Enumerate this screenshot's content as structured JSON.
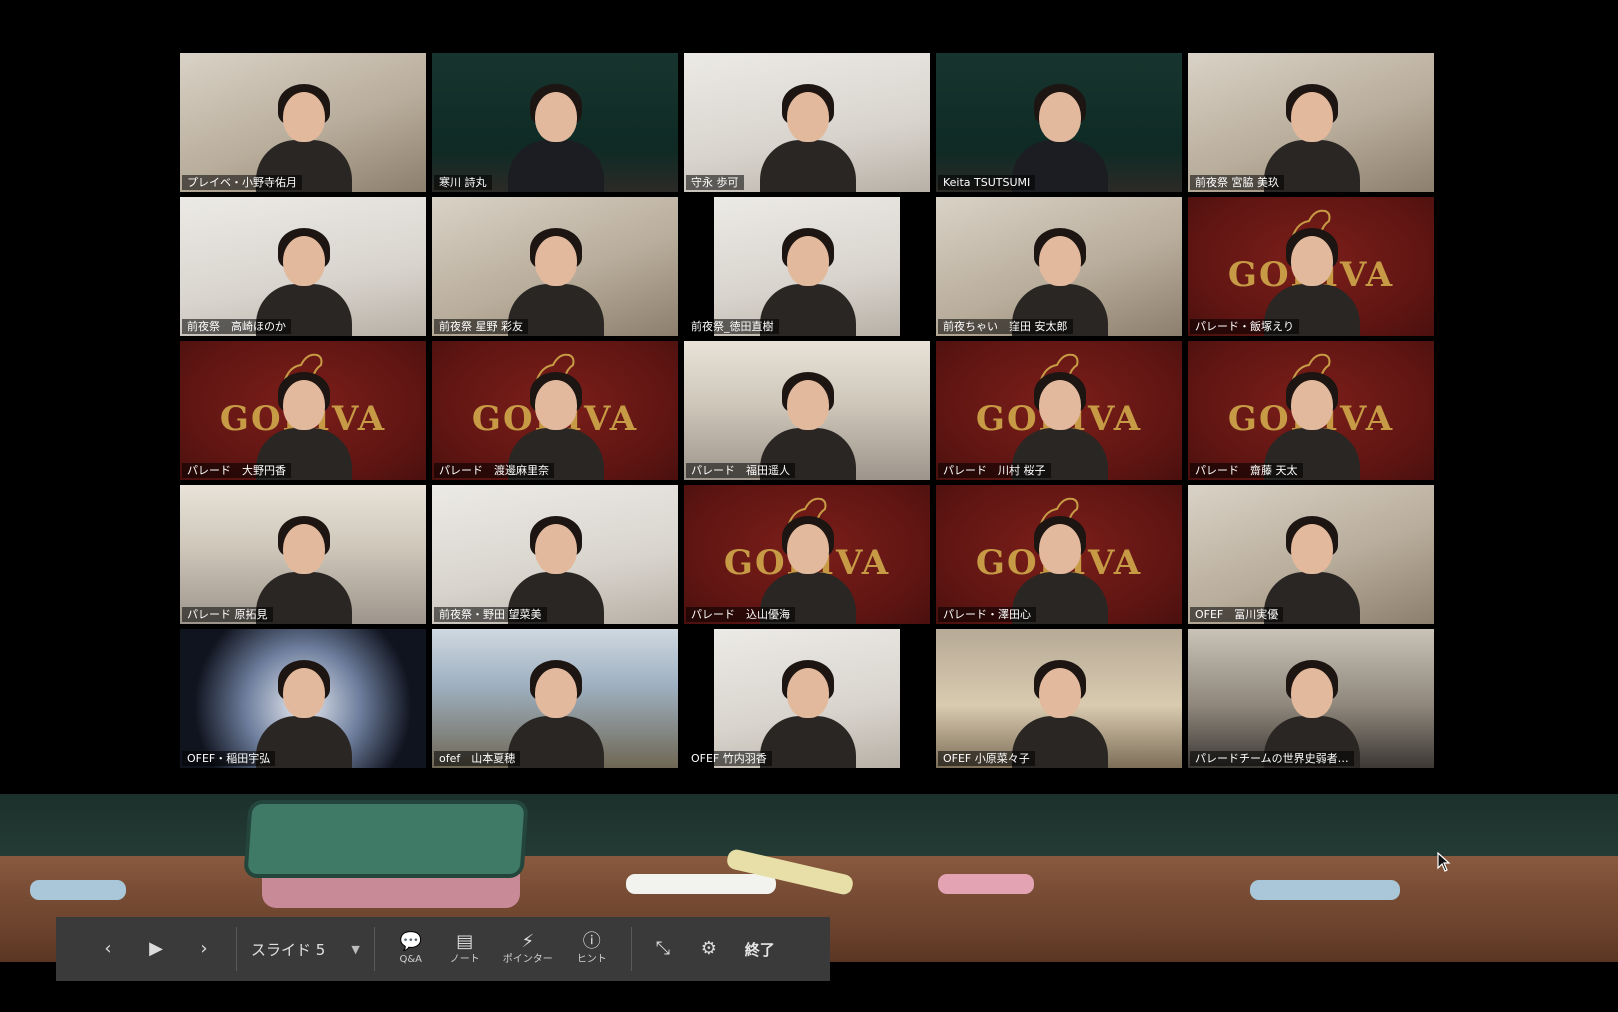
{
  "participants": [
    {
      "name": "プレイベ・小野寺佑月",
      "bg": "room",
      "active": false
    },
    {
      "name": "寒川 詩丸",
      "bg": "board",
      "active": true
    },
    {
      "name": "守永 歩可",
      "bg": "white",
      "active": false
    },
    {
      "name": "Keita TSUTSUMI",
      "bg": "board",
      "active": false
    },
    {
      "name": "前夜祭 宮脇 美玖",
      "bg": "room",
      "active": false
    },
    {
      "name": "前夜祭　高崎ほのか",
      "bg": "white",
      "active": false
    },
    {
      "name": "前夜祭 星野 彩友",
      "bg": "room",
      "active": false
    },
    {
      "name": "前夜祭_徳田直樹",
      "bg": "white",
      "active": false,
      "pillar": true
    },
    {
      "name": "前夜ちゃい　窪田 安太郎",
      "bg": "room",
      "active": false
    },
    {
      "name": "パレード・飯塚えり",
      "bg": "godiva",
      "active": false
    },
    {
      "name": "パレード　大野円香",
      "bg": "godiva",
      "active": false
    },
    {
      "name": "パレード　渡邊麻里奈",
      "bg": "godiva",
      "active": false
    },
    {
      "name": "パレード　福田遥人",
      "bg": "floor",
      "active": false
    },
    {
      "name": "パレード　川村 桜子",
      "bg": "godiva",
      "active": false
    },
    {
      "name": "パレード　齋藤 天太",
      "bg": "godiva",
      "active": false
    },
    {
      "name": "パレード 原拓見",
      "bg": "floor",
      "active": false
    },
    {
      "name": "前夜祭・野田 望菜美",
      "bg": "white",
      "active": false
    },
    {
      "name": "パレード　込山優海",
      "bg": "godiva",
      "active": false
    },
    {
      "name": "パレード・澤田心",
      "bg": "godiva",
      "active": false
    },
    {
      "name": "OFEF　冨川実優",
      "bg": "room",
      "active": false
    },
    {
      "name": "OFEF・稲田宇弘",
      "bg": "manga",
      "active": false
    },
    {
      "name": "ofef　山本夏穂",
      "bg": "anime",
      "active": false
    },
    {
      "name": "OFEF 竹内羽香",
      "bg": "white",
      "active": false,
      "pillar": true
    },
    {
      "name": "OFEF 小原菜々子",
      "bg": "couch",
      "active": false
    },
    {
      "name": "パレードチームの世界史弱者…",
      "bg": "dark",
      "active": false
    }
  ],
  "godiva_brand": "GODIVA",
  "toolbar": {
    "prev_icon": "chevron-left-icon",
    "play_icon": "play-icon",
    "next_icon": "chevron-right-icon",
    "slide_label": "スライド 5",
    "qa_label": "Q&A",
    "notes_label": "ノート",
    "pointer_label": "ポインター",
    "hint_label": "ヒント",
    "end_label": "終了"
  },
  "colors": {
    "active_border": "#d8dc7a",
    "toolbar_bg": "#3a3a3a",
    "chalk_blue": "#a9c7d8",
    "chalk_white": "#f2f2ee",
    "chalk_yellow": "#e8dfa8",
    "chalk_pink": "#e3a3b3"
  }
}
